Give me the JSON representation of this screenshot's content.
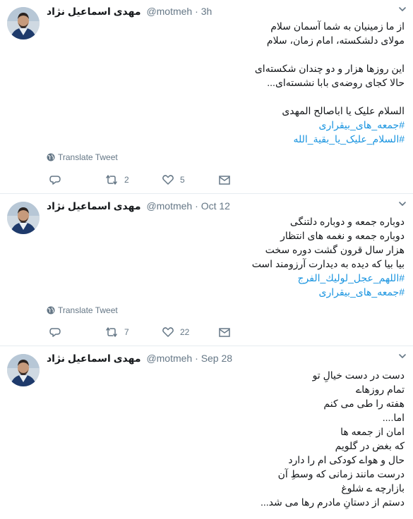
{
  "tweets": [
    {
      "name": "مهدی اسماعیل نژاد",
      "handle": "@motmeh",
      "separator": "·",
      "time": "3h",
      "lines": [
        {
          "text": "از ما زمینیان به شما آسمان سلام",
          "hashtag": false
        },
        {
          "text": "مولای دلشکسته، امام زمان، سلام",
          "hashtag": false
        },
        {
          "text": "",
          "hashtag": false
        },
        {
          "text": "این روزها هزار و دو چندان شکسته‌ای",
          "hashtag": false
        },
        {
          "text": "حالا کجای روضه‌ی بابا نشسته‌ای...",
          "hashtag": false
        },
        {
          "text": "",
          "hashtag": false
        },
        {
          "text": "السلام علیک یا اباصالح المهدی",
          "hashtag": false
        },
        {
          "text": "#جمعه_های_بیقراری",
          "hashtag": true
        },
        {
          "text": "#السلام_علیک_یا_بقیة_الله",
          "hashtag": true
        }
      ],
      "translate_label": "Translate Tweet",
      "retweets": "2",
      "likes": "5",
      "icons": {
        "reply": "reply-icon",
        "retweet": "retweet-icon",
        "like": "heart-icon",
        "dm": "envelope-icon",
        "more": "chevron-down-icon",
        "globe": "globe-icon"
      }
    },
    {
      "name": "مهدی اسماعیل نژاد",
      "handle": "@motmeh",
      "separator": "·",
      "time": "Oct 12",
      "lines": [
        {
          "text": "دوباره جمعه و دوباره دلتنگی",
          "hashtag": false
        },
        {
          "text": "دوباره جمعه و نغمه های انتظار",
          "hashtag": false
        },
        {
          "text": "هزار سال قرون گشت دوره سخت",
          "hashtag": false
        },
        {
          "text": "بیا بیا که دیده به دیدارت آرزومند است",
          "hashtag": false
        },
        {
          "text": "#اللهم_عجل_لولیك_الفرج",
          "hashtag": true
        },
        {
          "text": "#جمعه_های_بیقراری",
          "hashtag": true
        }
      ],
      "translate_label": "Translate Tweet",
      "retweets": "7",
      "likes": "22"
    },
    {
      "name": "مهدی اسماعیل نژاد",
      "handle": "@motmeh",
      "separator": "·",
      "time": "Sep 28",
      "lines": [
        {
          "text": "دست در دست خیالِ تو",
          "hashtag": false
        },
        {
          "text": "تمام روزهاے",
          "hashtag": false
        },
        {
          "text": "هفته را طی می کنم",
          "hashtag": false
        },
        {
          "text": "اما....",
          "hashtag": false
        },
        {
          "text": "امان از جمعه ها",
          "hashtag": false
        },
        {
          "text": "که بغض در گلویم",
          "hashtag": false
        },
        {
          "text": "حال و هواے کودکی ام را دارد",
          "hashtag": false
        },
        {
          "text": "درست مانند زمانی که وسطِ آن",
          "hashtag": false
        },
        {
          "text": "بازارچه ے شلوغ",
          "hashtag": false
        },
        {
          "text": "دستم از دستانِ مادرم رها می شد...",
          "hashtag": false
        }
      ]
    }
  ],
  "colors": {
    "link": "#1b95e0",
    "muted": "#657786",
    "text": "#14171a",
    "divider": "#e6ecf0"
  }
}
